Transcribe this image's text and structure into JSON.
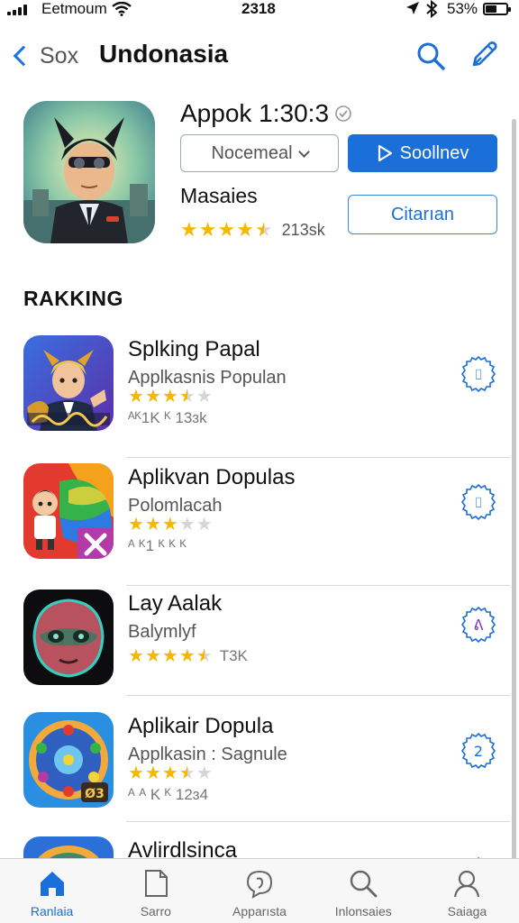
{
  "status_bar": {
    "carrier": "Eetmoum",
    "time": "2318",
    "battery_pct": "53%",
    "battery_level": 0.53
  },
  "nav": {
    "back_label": "Sox",
    "title": "Undonasia",
    "search_icon": "search-icon",
    "compose_icon": "compose-icon"
  },
  "hero": {
    "title": "Appok 1:30:3",
    "select_label": "Nocemeal",
    "primary_label": "Soollnev",
    "secondary_label": "Citarıan",
    "subtitle": "Masaies",
    "rating": 4.5,
    "rating_count": "213sk"
  },
  "section": {
    "title": "RAKKING"
  },
  "apps": [
    {
      "title": "Splking Papal",
      "subtitle": "Applkasnis Populan",
      "rating": 3.5,
      "meta": "ᴬᴷ1K ᴷ 13ɜk",
      "inline_meta": "",
      "button_glyph": "⌷"
    },
    {
      "title": "Aplikvan Dopulas",
      "subtitle": "Polomlacah",
      "rating": 3,
      "meta": "ᴬ ᴷ1 ᴷ ᴷ ᴷ",
      "inline_meta": "",
      "button_glyph": "⌷"
    },
    {
      "title": "Lay Aalak",
      "subtitle": "Balymlyf",
      "rating": 4.5,
      "meta": "",
      "inline_meta": "T3K",
      "button_glyph": "ᕕ"
    },
    {
      "title": "Aplikair Dopula",
      "subtitle": "Applkasin : Sagnule",
      "rating": 3.5,
      "meta": "ᴬ ᴬ K ᴷ 12ɜ4",
      "inline_meta": "",
      "button_glyph": "2"
    },
    {
      "title": "Avlirdlsinca",
      "subtitle": "",
      "rating": 0,
      "meta": "",
      "inline_meta": "",
      "button_glyph": ""
    }
  ],
  "tabs": [
    {
      "label": "Ranlaia",
      "icon": "home-icon",
      "active": true
    },
    {
      "label": "Sarro",
      "icon": "document-icon",
      "active": false
    },
    {
      "label": "Apparısta",
      "icon": "chat-icon",
      "active": false
    },
    {
      "label": "Inlonsaies",
      "icon": "search-icon",
      "active": false
    },
    {
      "label": "Saiaga",
      "icon": "profile-icon",
      "active": false
    }
  ],
  "colors": {
    "accent": "#1a6fd8",
    "star": "#f5b800",
    "divider": "#d9d9d9"
  }
}
